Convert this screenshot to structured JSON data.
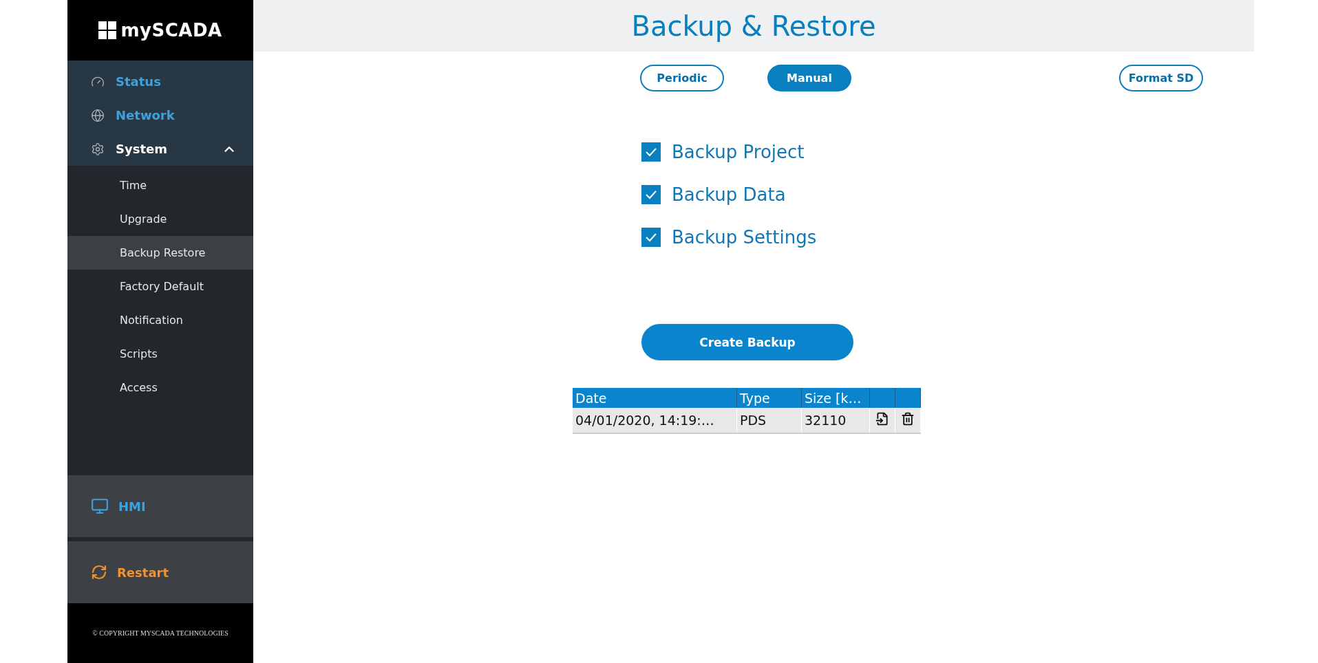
{
  "logo": "mySCADA",
  "nav": [
    {
      "label": "Status",
      "kind": "status",
      "expanded": false
    },
    {
      "label": "Network",
      "kind": "network",
      "expanded": false
    },
    {
      "label": "System",
      "kind": "system",
      "expanded": true,
      "children": [
        {
          "label": "Time",
          "selected": false
        },
        {
          "label": "Upgrade",
          "selected": false
        },
        {
          "label": "Backup Restore",
          "selected": true
        },
        {
          "label": "Factory Default",
          "selected": false
        },
        {
          "label": "Notification",
          "selected": false
        },
        {
          "label": "Scripts",
          "selected": false
        },
        {
          "label": "Access",
          "selected": false
        }
      ]
    }
  ],
  "hmi": "HMI",
  "restart": "Restart",
  "copyright": "© COPYRIGHT MYSCADA TECHNOLOGIES",
  "title": "Backup & Restore",
  "modes": [
    {
      "label": "Periodic",
      "selected": false
    },
    {
      "label": "Manual",
      "selected": true
    }
  ],
  "format_button": "Format SD",
  "options": [
    {
      "label": "Backup Project",
      "checked": true
    },
    {
      "label": "Backup Data",
      "checked": true
    },
    {
      "label": "Backup Settings",
      "checked": true
    }
  ],
  "create_button": "Create Backup",
  "table": {
    "columns": [
      "Date",
      "Type",
      "Size [k…"
    ],
    "rows": [
      {
        "date": "04/01/2020, 14:19:…",
        "type": "PDS",
        "size": "32110"
      }
    ]
  }
}
